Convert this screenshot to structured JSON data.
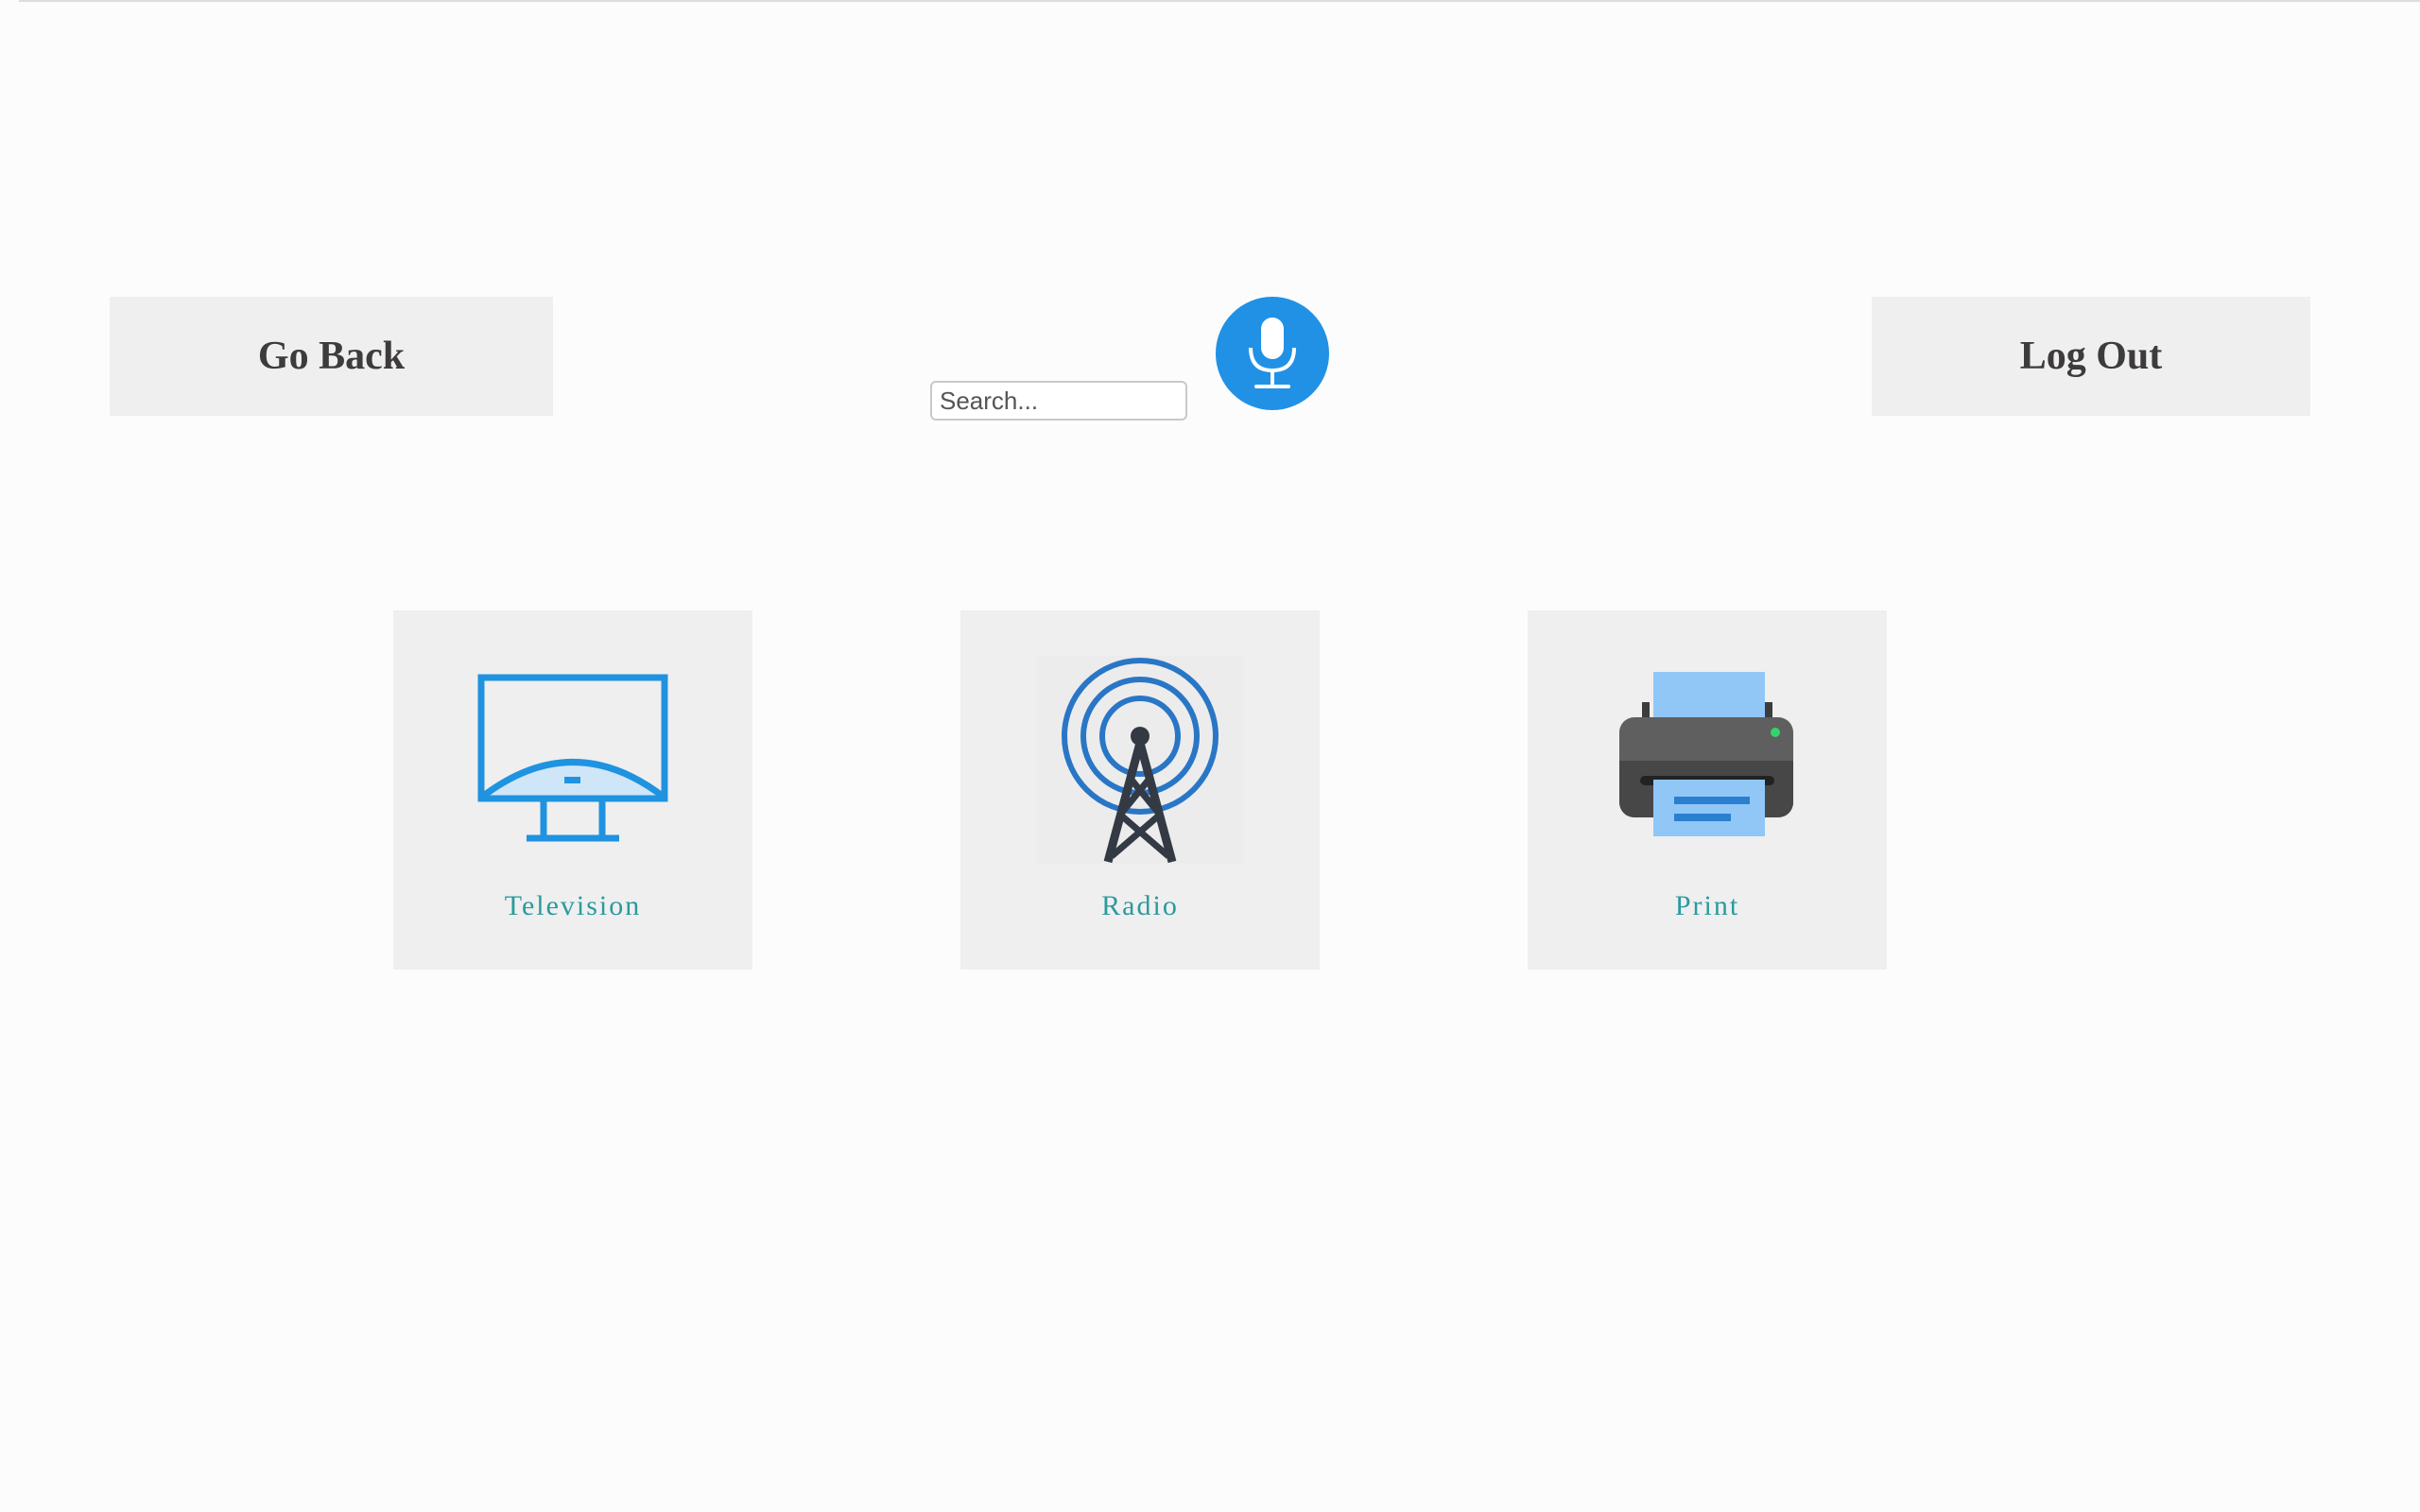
{
  "header": {
    "go_back_label": "Go Back",
    "log_out_label": "Log Out"
  },
  "search": {
    "placeholder": "Search...",
    "value": ""
  },
  "mic": {
    "icon": "microphone-icon",
    "color": "#2191e6"
  },
  "tiles": [
    {
      "label": "Television",
      "icon": "television-icon"
    },
    {
      "label": "Radio",
      "icon": "radio-tower-icon"
    },
    {
      "label": "Print",
      "icon": "printer-icon"
    }
  ],
  "colors": {
    "label": "#2a9a9e",
    "tile_bg": "#efefef",
    "button_text": "#3d3b3b"
  }
}
